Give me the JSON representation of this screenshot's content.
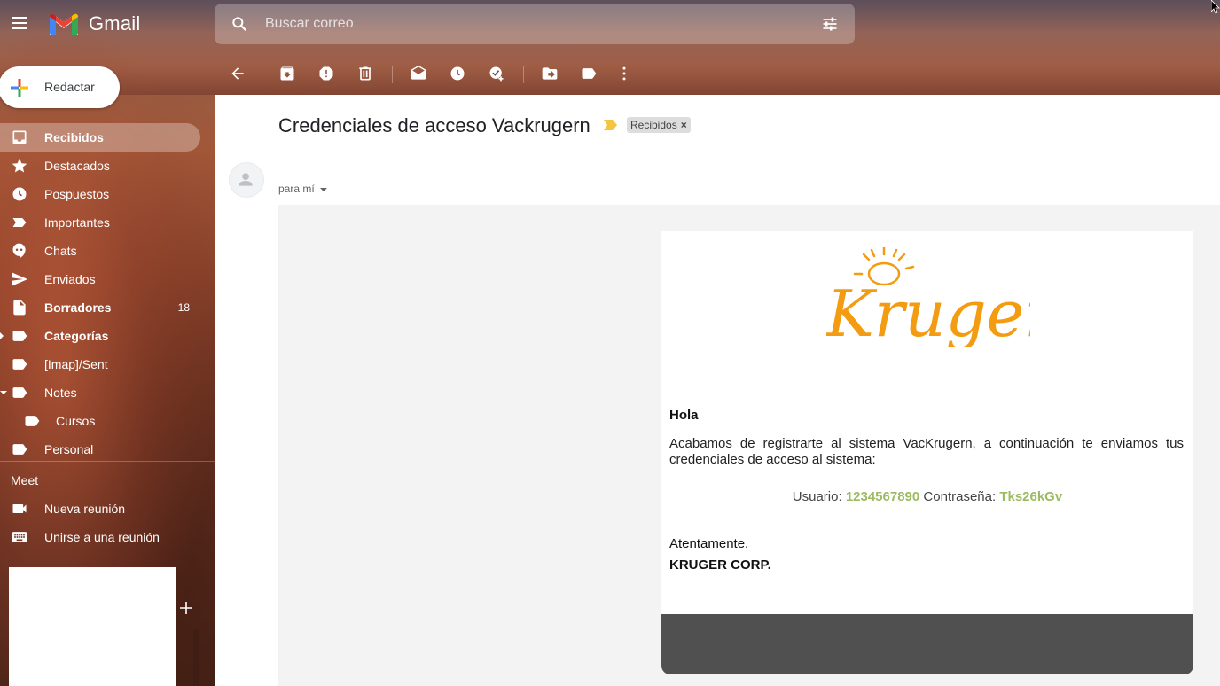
{
  "app": {
    "name": "Gmail"
  },
  "search": {
    "placeholder": "Buscar correo"
  },
  "compose": {
    "label": "Redactar"
  },
  "sidebar": {
    "items": [
      {
        "label": "Recibidos",
        "icon": "inbox-icon",
        "active": true,
        "bold": true
      },
      {
        "label": "Destacados",
        "icon": "star-icon"
      },
      {
        "label": "Pospuestos",
        "icon": "clock-icon"
      },
      {
        "label": "Importantes",
        "icon": "important-icon"
      },
      {
        "label": "Chats",
        "icon": "chat-icon"
      },
      {
        "label": "Enviados",
        "icon": "send-icon"
      },
      {
        "label": "Borradores",
        "icon": "draft-icon",
        "bold": true,
        "count": "18"
      },
      {
        "label": "Categorías",
        "icon": "label-icon",
        "bold": true,
        "expand": "right"
      },
      {
        "label": "[Imap]/Sent",
        "icon": "label-icon"
      },
      {
        "label": "Notes",
        "icon": "label-icon",
        "expand": "down"
      },
      {
        "label": "Cursos",
        "icon": "label-icon",
        "sub": true
      },
      {
        "label": "Personal",
        "icon": "label-icon"
      }
    ]
  },
  "meet": {
    "title": "Meet",
    "items": [
      {
        "label": "Nueva reunión",
        "icon": "video-icon"
      },
      {
        "label": "Unirse a una reunión",
        "icon": "keyboard-icon"
      }
    ]
  },
  "toolbar": {
    "buttons": [
      "back-icon",
      "archive-icon",
      "report-spam-icon",
      "delete-icon",
      "mark-unread-icon",
      "snooze-icon",
      "add-task-icon",
      "move-to-icon",
      "labels-icon",
      "more-icon"
    ]
  },
  "email": {
    "subject": "Credenciales de acceso Vackrugern",
    "label_chip": "Recibidos",
    "label_chip_close": "×",
    "recipient": "para mí",
    "logo_text": "Kruger",
    "greeting": "Hola",
    "body": "Acabamos de registrarte al sistema VacKrugern, a continuación te enviamos tus credenciales de acceso al sistema:",
    "user_label": "Usuario:",
    "user_value": "1234567890",
    "pass_label": "Contraseña:",
    "pass_value": "Tks26kGv",
    "closing": "Atentamente.",
    "company": "KRUGER CORP."
  },
  "colors": {
    "accent_orange": "#f39c12",
    "credential_green": "#9dbb61",
    "footer_gray": "#505050",
    "important_yellow": "#f4c542"
  }
}
